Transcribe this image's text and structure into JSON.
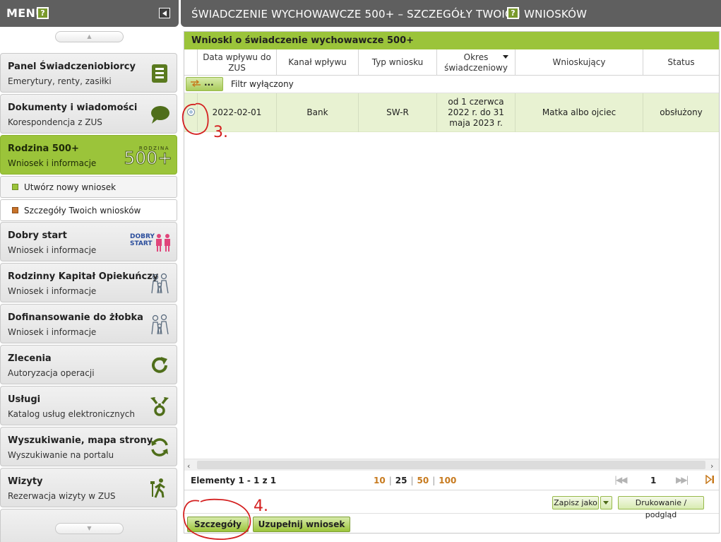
{
  "sidebar": {
    "title": "MENU",
    "help": "?",
    "scroll_up": "▲",
    "scroll_down": "▼",
    "items": [
      {
        "title": "Panel Świadczeniobiorcy",
        "subtitle": "Emerytury, renty, zasiłki",
        "icon": "document-stack-icon"
      },
      {
        "title": "Dokumenty i wiadomości",
        "subtitle": "Korespondencja z ZUS",
        "icon": "speech-bubble-icon"
      },
      {
        "title": "Rodzina 500+",
        "subtitle": "Wniosek i informacje",
        "icon": "rodzina-500-logo",
        "active": true
      },
      {
        "title": "Dobry start",
        "subtitle": "Wniosek i informacje",
        "icon": "dobry-start-logo"
      },
      {
        "title": "Rodzinny Kapitał Opiekuńczy",
        "subtitle": "Wniosek i informacje",
        "icon": "family-icon"
      },
      {
        "title": "Dofinansowanie do żłobka",
        "subtitle": "Wniosek i informacje",
        "icon": "family-icon"
      },
      {
        "title": "Zlecenia",
        "subtitle": "Autoryzacja operacji",
        "icon": "refresh-arrow-icon"
      },
      {
        "title": "Usługi",
        "subtitle": "Katalog usług elektronicznych",
        "icon": "services-icon"
      },
      {
        "title": "Wyszukiwanie, mapa strony",
        "subtitle": "Wyszukiwanie na portalu",
        "icon": "sync-icon"
      },
      {
        "title": "Wizyty",
        "subtitle": "Rezerwacja wizyty w ZUS",
        "icon": "walking-person-icon"
      }
    ],
    "subitems": [
      {
        "label": "Utwórz nowy wniosek"
      },
      {
        "label": "Szczegóły Twoich wniosków",
        "active": true
      }
    ],
    "logo_texts": {
      "rodzina_small": "RODZINA",
      "rodzina_big": "500+",
      "dobry": "DOBRY",
      "start": "START"
    }
  },
  "header": {
    "title": "ŚWIADCZENIE WYCHOWAWCZE 500+ – SZCZEGÓŁY TWOICH WNIOSKÓW",
    "help": "?"
  },
  "panel": {
    "title": "Wnioski o świadczenie wychowawcze 500+",
    "columns": [
      "Data wpływu do ZUS",
      "Kanał wpływu",
      "Typ wniosku",
      "Okres świadczeniowy",
      "Wnioskujący",
      "Status"
    ],
    "filter_button": "...",
    "filter_label": "Filtr wyłączony",
    "rows": [
      {
        "date": "2022-02-01",
        "channel": "Bank",
        "type": "SW-R",
        "period": "od 1 czerwca 2022 r. do 31 maja 2023 r.",
        "applicant": "Matka albo ojciec",
        "status": "obsłużony",
        "selected": true
      }
    ],
    "pager": {
      "elements": "Elementy 1 - 1 z 1",
      "page_sizes": [
        "10",
        "25",
        "50",
        "100"
      ],
      "current_page_size": "25",
      "current_page": "1"
    },
    "buttons": {
      "save_as": "Zapisz jako",
      "print": "Drukowanie / podgląd",
      "details": "Szczegóły",
      "complete": "Uzupełnij wniosek"
    }
  },
  "annotations": {
    "step3": "3.",
    "step4": "4.",
    "color": "#d42020"
  },
  "colors": {
    "accent": "#9bc43a",
    "header_bg": "#5f5f5f",
    "selected_row": "#e8f2d2",
    "link_orange": "#c77a1e"
  }
}
